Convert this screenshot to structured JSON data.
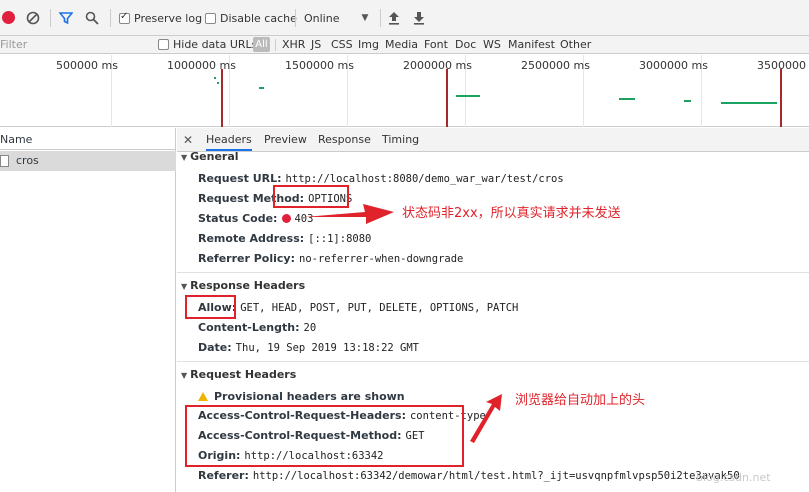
{
  "toolbar": {
    "preserve_log": "Preserve log",
    "disable_cache": "Disable cache",
    "throttle": "Online"
  },
  "filterbar": {
    "filter_placeholder": "Filter",
    "hide_data_urls": "Hide data URLs",
    "all": "All",
    "types": [
      "XHR",
      "JS",
      "CSS",
      "Img",
      "Media",
      "Font",
      "Doc",
      "WS",
      "Manifest",
      "Other"
    ]
  },
  "timeline": {
    "ticks": [
      "500000 ms",
      "1000000 ms",
      "1500000 ms",
      "2000000 ms",
      "2500000 ms",
      "3000000 ms",
      "3500000 ms"
    ]
  },
  "list": {
    "name_header": "Name",
    "selected_request": "cros"
  },
  "detail": {
    "tabs": [
      "Headers",
      "Preview",
      "Response",
      "Timing"
    ],
    "general": {
      "title": "General",
      "rows": [
        {
          "key": "Request URL:",
          "value": "http://localhost:8080/demo_war_war/test/cros"
        },
        {
          "key": "Request Method:",
          "value": "OPTIONS"
        },
        {
          "key": "Status Code:",
          "value": "403"
        },
        {
          "key": "Remote Address:",
          "value": "[::1]:8080"
        },
        {
          "key": "Referrer Policy:",
          "value": "no-referrer-when-downgrade"
        }
      ]
    },
    "response_headers": {
      "title": "Response Headers",
      "rows": [
        {
          "key": "Allow:",
          "value": "GET, HEAD, POST, PUT, DELETE, OPTIONS, PATCH"
        },
        {
          "key": "Content-Length:",
          "value": "20"
        },
        {
          "key": "Date:",
          "value": "Thu, 19 Sep 2019 13:18:22 GMT"
        }
      ]
    },
    "request_headers": {
      "title": "Request Headers",
      "provisional": "Provisional headers are shown",
      "rows": [
        {
          "key": "Access-Control-Request-Headers:",
          "value": "content-type"
        },
        {
          "key": "Access-Control-Request-Method:",
          "value": "GET"
        },
        {
          "key": "Origin:",
          "value": "http://localhost:63342"
        },
        {
          "key": "Referer:",
          "value": "http://localhost:63342/demowar/html/test.html?_ijt=usvqnpfmlvpsp50i2te3avak50"
        }
      ]
    }
  },
  "annotations": {
    "note_status": "状态码非2xx，所以真实请求并未发送",
    "note_headers": "浏览器给自动加上的头",
    "watermark": "blog.csdn.net"
  },
  "colors": {
    "annotation": "#e0232b",
    "record": "#e0203c",
    "timeline_bar": "#1aa260"
  }
}
